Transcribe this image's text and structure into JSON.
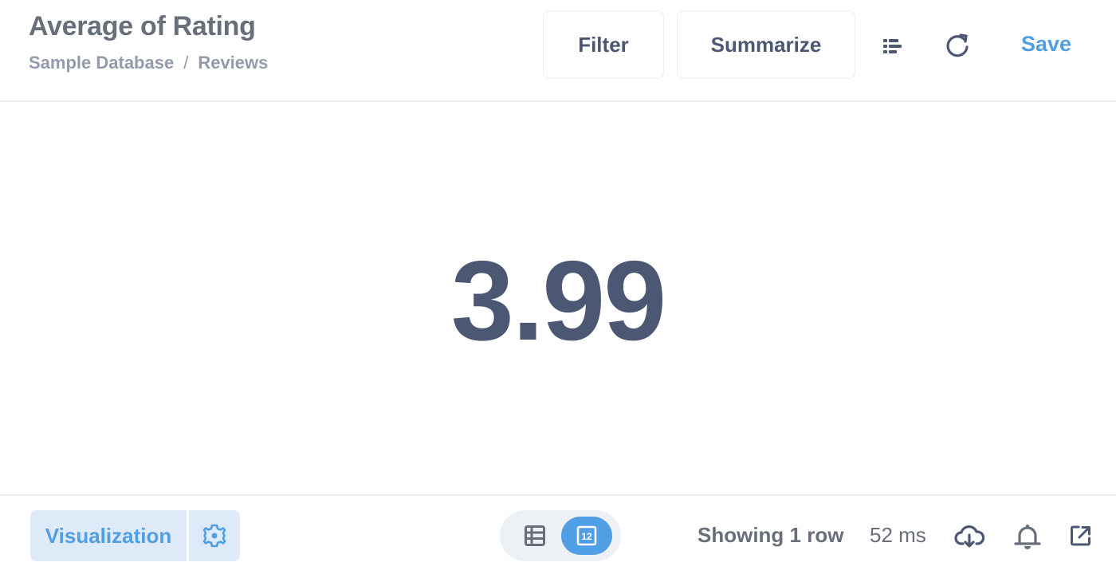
{
  "header": {
    "title": "Average of Rating",
    "breadcrumb": [
      {
        "label": "Sample Database"
      },
      {
        "label": "Reviews"
      }
    ],
    "breadcrumb_separator": "/",
    "filter_label": "Filter",
    "summarize_label": "Summarize",
    "save_label": "Save",
    "icons": {
      "notebook": "list-bullets-icon",
      "refresh": "refresh-icon"
    }
  },
  "main": {
    "scalar_value": "3.99"
  },
  "footer": {
    "visualization_label": "Visualization",
    "settings_icon": "gear-icon",
    "view_toggle": {
      "options": [
        "table",
        "scalar"
      ],
      "active": "scalar",
      "scalar_badge": "12"
    },
    "row_count": "Showing 1 row",
    "query_time": "52 ms",
    "icons": {
      "download": "cloud-download-icon",
      "alert": "bell-icon",
      "share": "external-link-icon"
    }
  },
  "colors": {
    "brand": "#509ee3",
    "text_dark": "#4c5773",
    "text_medium": "#696e7b",
    "text_light": "#949aab",
    "brand_light_bg": "#deeaf8"
  }
}
